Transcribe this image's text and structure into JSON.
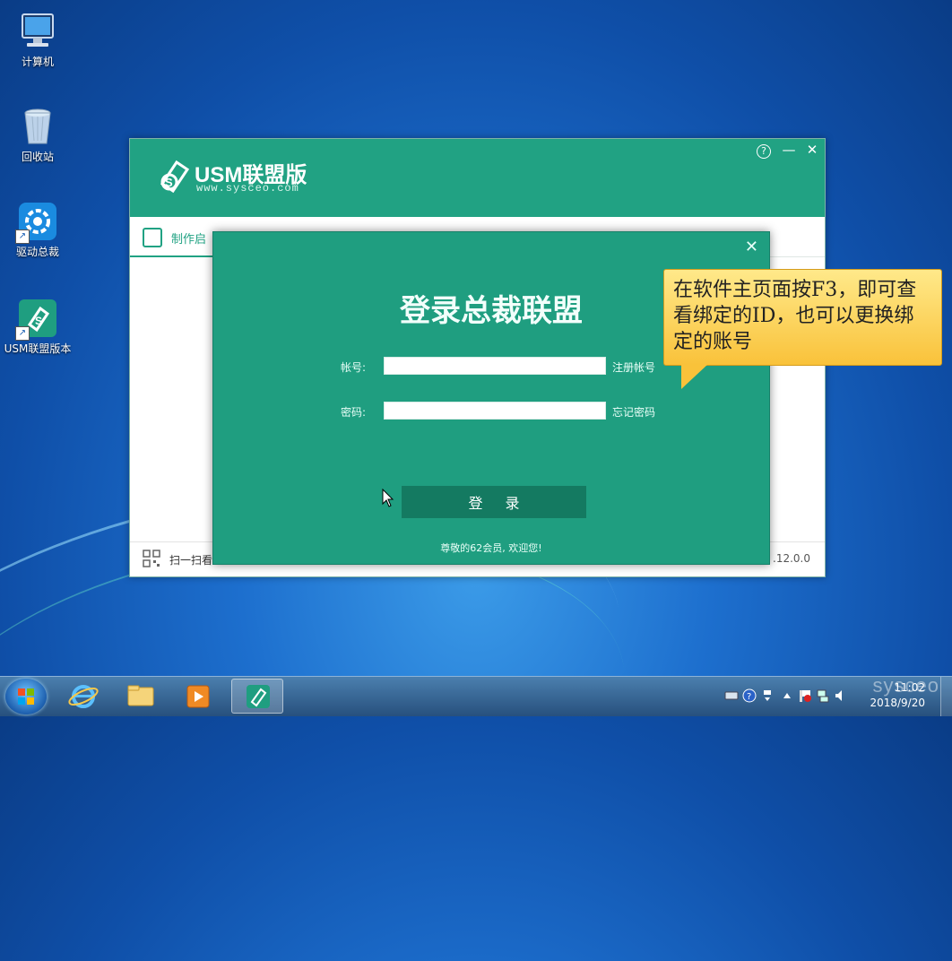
{
  "desktop": {
    "icons": [
      {
        "label": "计算机",
        "icon": "computer-icon"
      },
      {
        "label": "回收站",
        "icon": "recycle-bin-icon"
      },
      {
        "label": "驱动总裁",
        "icon": "driver-tool-icon"
      },
      {
        "label": "USM联盟版本",
        "icon": "usm-icon"
      }
    ]
  },
  "main_window": {
    "brand": "USM联盟版",
    "brand_sub": "www.sysceo.com",
    "help_icon": "?",
    "minimize_icon": "—",
    "close_icon": "✕",
    "tab_label": "制作启",
    "footer_scan": "扫一扫看",
    "version": ".12.0.0"
  },
  "login_dialog": {
    "close_icon": "✕",
    "title": "登录总裁联盟",
    "account_label": "帐号:",
    "account_value": "",
    "register_link": "注册帐号",
    "password_label": "密码:",
    "password_value": "",
    "forgot_link": "忘记密码",
    "login_button": "登 录",
    "welcome": "尊敬的62会员, 欢迎您!"
  },
  "callout": {
    "text": "在软件主页面按F3，即可查看绑定的ID，也可以更换绑定的账号"
  },
  "taskbar": {
    "time": "11:02",
    "date": "2018/9/20",
    "watermark": "sysceo",
    "colors": {
      "accent": "#21a283",
      "taskbar": "#27507d"
    }
  }
}
